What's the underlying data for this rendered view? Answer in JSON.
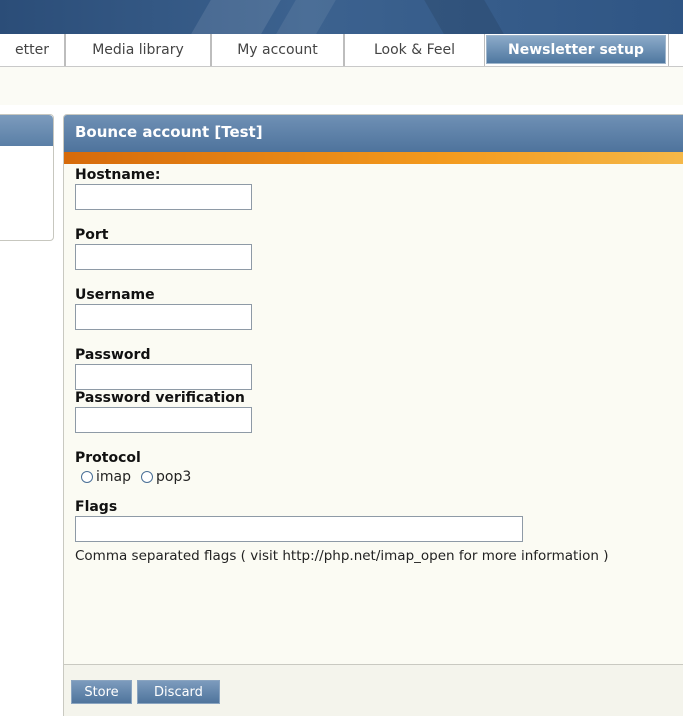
{
  "tabs": [
    {
      "label": "etter",
      "active": false
    },
    {
      "label": "Media library",
      "active": false
    },
    {
      "label": "My account",
      "active": false
    },
    {
      "label": "Look & Feel",
      "active": false
    },
    {
      "label": "Newsletter setup",
      "active": true
    }
  ],
  "panel": {
    "title": "Bounce account [Test]"
  },
  "form": {
    "hostname": {
      "label": "Hostname:",
      "value": ""
    },
    "port": {
      "label": "Port",
      "value": ""
    },
    "username": {
      "label": "Username",
      "value": ""
    },
    "password": {
      "label": "Password",
      "value": ""
    },
    "password_verification": {
      "label": "Password verification",
      "value": ""
    },
    "protocol": {
      "label": "Protocol",
      "options": [
        "imap",
        "pop3"
      ],
      "selected": null
    },
    "flags": {
      "label": "Flags",
      "value": "",
      "help": "Comma separated flags ( visit http://php.net/imap_open for more information )"
    }
  },
  "buttons": {
    "store": "Store",
    "discard": "Discard"
  },
  "colors": {
    "banner": "#2f5584",
    "panel_header": "#5a7fa6",
    "accent_orange": "#f39a1d",
    "background": "#fbfbf3"
  }
}
